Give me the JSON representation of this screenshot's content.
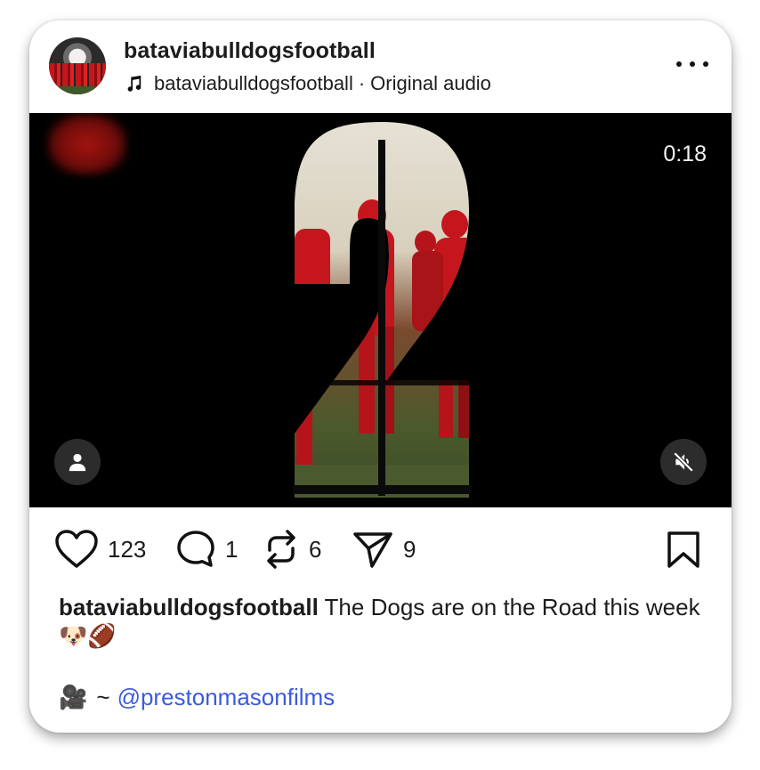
{
  "post": {
    "username": "bataviabulldogsfootball",
    "audio": {
      "artist": "bataviabulldogsfootball",
      "separator": "·",
      "track": "Original audio",
      "icon": "music-note-icon"
    },
    "media": {
      "timer": "0:18",
      "big_number": "2"
    },
    "stats": {
      "likes": "123",
      "comments": "1",
      "reposts": "6",
      "shares": "9"
    },
    "caption": {
      "user": "bataviabulldogsfootball",
      "text": " The Dogs are on the Road this week ",
      "emojis": "🐶🏈"
    },
    "credit": {
      "emoji": "🎥",
      "tilde": "~",
      "mention": "@prestonmasonfilms"
    }
  },
  "colors": {
    "mention": "#3b5bdb",
    "jersey_red": "#c4161c",
    "text": "#1c1c1c"
  }
}
